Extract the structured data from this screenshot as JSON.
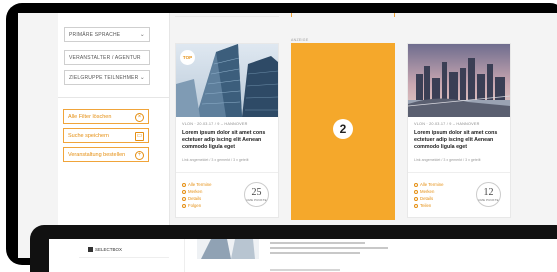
{
  "filters": {
    "selects": [
      {
        "label": "PRIMÄRE SPRACHE"
      },
      {
        "label": "VERANSTALTER / AGENTUR"
      },
      {
        "label": "ZIELGRUPPE TEILNEHMER"
      }
    ],
    "actions": [
      {
        "label": "Alle Filter löschen",
        "icon": "close-circle-icon"
      },
      {
        "label": "Suche speichern",
        "icon": "save-icon"
      },
      {
        "label": "Veranstaltung bestellen",
        "icon": "plus-circle-icon"
      }
    ]
  },
  "cards": [
    {
      "badge": "TOP",
      "meta": "VLON · 20.03.17 / 9 – HANNOVER",
      "title": "Lorem ipsum dolor sit amet cons ectetuer adip iscing elit Aenean commodo ligula eget",
      "category": "Link angemeldet / 3 x gemerkt / 3 x geteilt",
      "actions": [
        "Alle Termine",
        "Merken",
        "Details",
        "Folgen"
      ],
      "score": "25",
      "score_label": "CME PUNKTE"
    },
    {
      "meta": "VLON · 20.03.17 / 9 – HANNOVER",
      "title": "Lorem ipsum dolor sit amet cons ectetuer adip iscing elit Aenean commodo ligula eget",
      "category": "Link angemeldet / 3 x gemerkt / 3 x geteilt",
      "actions": [
        "Alle Termine",
        "Merken",
        "Details",
        "Teilen"
      ],
      "score": "12",
      "score_label": "CME PUNKTE"
    }
  ],
  "ad": {
    "label": "ANZEIGE",
    "number": "2",
    "color": "#f5a82b"
  },
  "second_screen": {
    "checkbox_label": "SELECTBOX"
  },
  "colors": {
    "accent": "#e58f12",
    "ad_orange": "#f5a82b"
  }
}
